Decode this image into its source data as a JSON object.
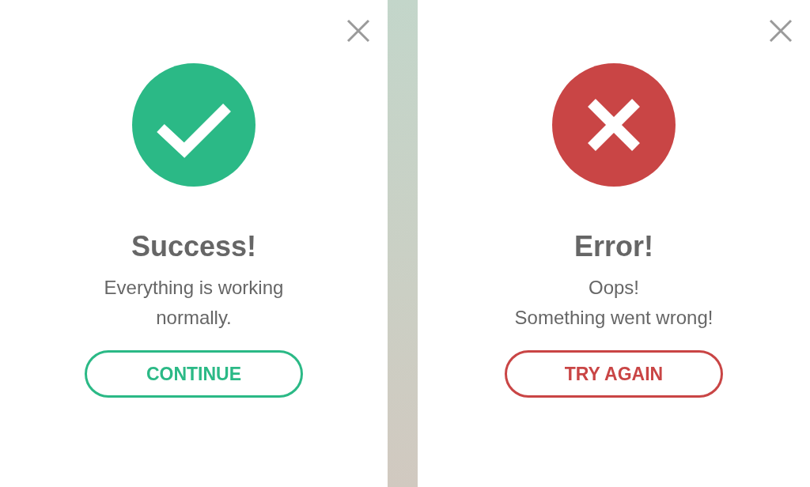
{
  "dialogs": [
    {
      "kind": "success",
      "color": "#2bb986",
      "title": "Success!",
      "message_lines": [
        "Everything is working",
        "normally."
      ],
      "button": "CONTINUE"
    },
    {
      "kind": "error",
      "color": "#c94545",
      "title": "Error!",
      "message_lines": [
        "Oops!",
        "Something went wrong!"
      ],
      "button": "TRY AGAIN"
    }
  ]
}
